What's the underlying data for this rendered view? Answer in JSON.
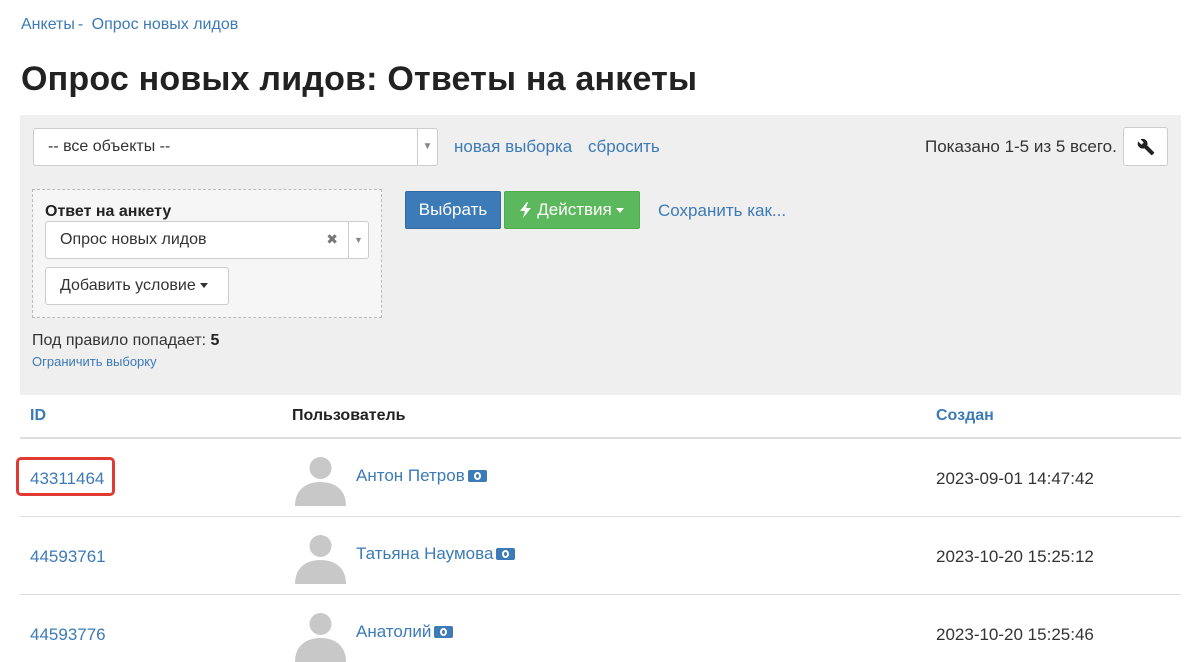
{
  "breadcrumb": {
    "root": "Анкеты",
    "separator": "-",
    "current": "Опрос новых лидов"
  },
  "page_title": "Опрос новых лидов: Ответы на анкеты",
  "filter": {
    "object_select": "-- все объекты --",
    "new_selection_link": "новая выборка",
    "reset_link": "сбросить",
    "shown_text": "Показано 1-5 из 5 всего.",
    "condition": {
      "title": "Ответ на анкету",
      "value": "Опрос новых лидов",
      "clear": "✖",
      "add_condition": "Добавить условие"
    },
    "select_button": "Выбрать",
    "actions_button": "Действия",
    "save_as_link": "Сохранить как...",
    "rule_count_label": "Под правило попадает:",
    "rule_count_value": "5",
    "limit_link": "Ограничить выборку"
  },
  "table": {
    "headers": {
      "id": "ID",
      "user": "Пользователь",
      "created": "Создан"
    },
    "rows": [
      {
        "id": "43311464",
        "user": "Антон Петров",
        "created": "2023-09-01 14:47:42"
      },
      {
        "id": "44593761",
        "user": "Татьяна Наумова",
        "created": "2023-10-20 15:25:12"
      },
      {
        "id": "44593776",
        "user": "Анатолий",
        "created": "2023-10-20 15:25:46"
      }
    ]
  },
  "highlight_color": "#e03a33",
  "icons": [
    "wrench-icon",
    "bolt-icon",
    "money-icon",
    "avatar-placeholder-icon"
  ]
}
